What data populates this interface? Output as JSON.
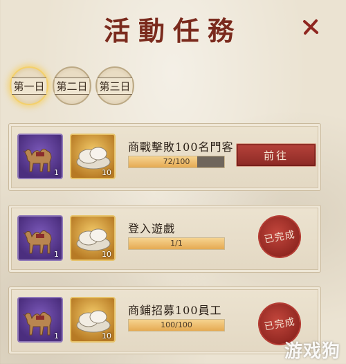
{
  "header": {
    "title": "活動任務"
  },
  "tabs": [
    {
      "label": "第一日",
      "active": true
    },
    {
      "label": "第二日",
      "active": false
    },
    {
      "label": "第三日",
      "active": false
    }
  ],
  "tasks": [
    {
      "name": "商戰擊敗100名門客",
      "rewards": [
        {
          "icon": "camel-icon",
          "qty": "1"
        },
        {
          "icon": "gold-ingot-icon",
          "qty": "10"
        }
      ],
      "progress_text": "72/100",
      "progress_fraction": 0.72,
      "action": "前往"
    },
    {
      "name": "登入遊戲",
      "rewards": [
        {
          "icon": "camel-icon",
          "qty": "1"
        },
        {
          "icon": "gold-ingot-icon",
          "qty": "10"
        }
      ],
      "progress_text": "1/1",
      "progress_fraction": 1.0,
      "status": "已完成"
    },
    {
      "name": "商鋪招募100員工",
      "rewards": [
        {
          "icon": "camel-icon",
          "qty": "1"
        },
        {
          "icon": "gold-ingot-icon",
          "qty": "10"
        }
      ],
      "progress_text": "100/100",
      "progress_fraction": 1.0,
      "status": "已完成"
    }
  ],
  "watermark": "游戏狗",
  "colors": {
    "title": "#7a2a1d",
    "button": "#a03630",
    "progress_fill": "#e5aa53",
    "active_tab_glow": "#f4d06a"
  }
}
